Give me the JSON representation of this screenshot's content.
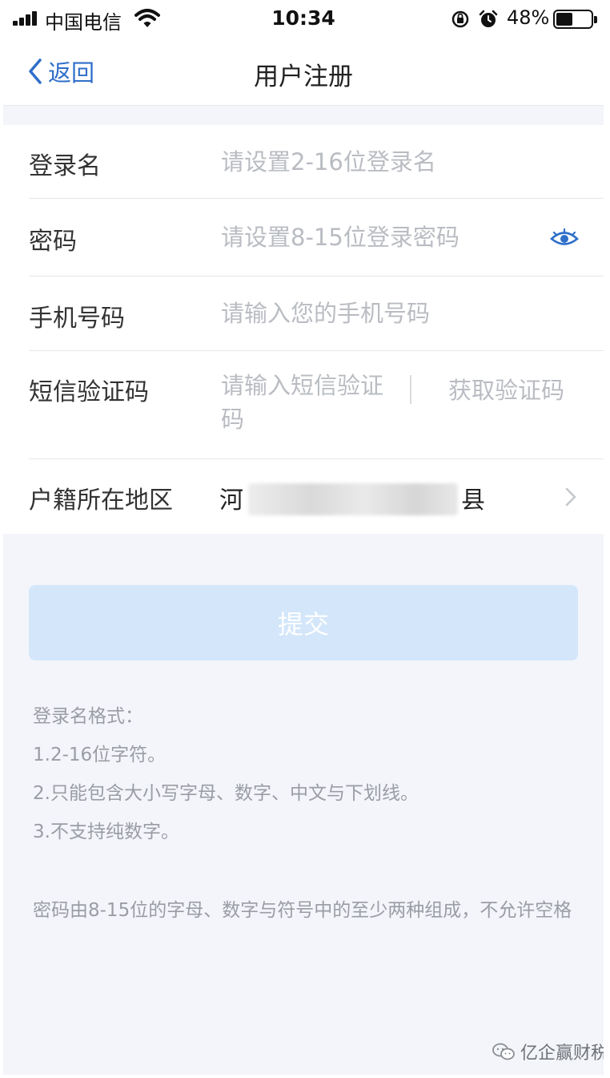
{
  "status_bar": {
    "carrier": "中国电信",
    "time": "10:34",
    "battery_percent": "48%",
    "battery_level": 0.48,
    "icons": [
      "signal-icon",
      "wifi-icon",
      "rotation-lock-icon",
      "alarm-icon",
      "battery-icon"
    ]
  },
  "nav": {
    "back_label": "返回",
    "title": "用户注册"
  },
  "form": {
    "login_name": {
      "label": "登录名",
      "placeholder": "请设置2-16位登录名",
      "value": ""
    },
    "password": {
      "label": "密码",
      "placeholder": "请设置8-15位登录密码",
      "value": ""
    },
    "phone": {
      "label": "手机号码",
      "placeholder": "请输入您的手机号码",
      "value": ""
    },
    "sms_code": {
      "label": "短信验证码",
      "placeholder": "请输入短信验证码",
      "value": "",
      "get_code_label": "获取验证码"
    },
    "region": {
      "label": "户籍所在地区",
      "value_prefix": "河",
      "value_suffix": "县"
    }
  },
  "submit_label": "提交",
  "hints": {
    "login_title": "登录名格式：",
    "login_rules": [
      "1.2-16位字符。",
      "2.只能包含大小写字母、数字、中文与下划线。",
      "3.不支持纯数字。"
    ],
    "password_rule": "密码由8-15位的字母、数字与符号中的至少两种组成，不允许空格"
  },
  "watermark": "亿企赢财税",
  "colors": {
    "accent": "#2f6fc9",
    "page_background": "#f3f5fa",
    "submit_disabled": "#d3e6fa",
    "placeholder": "#b9bcc2",
    "hint_text": "#9a9da3"
  }
}
